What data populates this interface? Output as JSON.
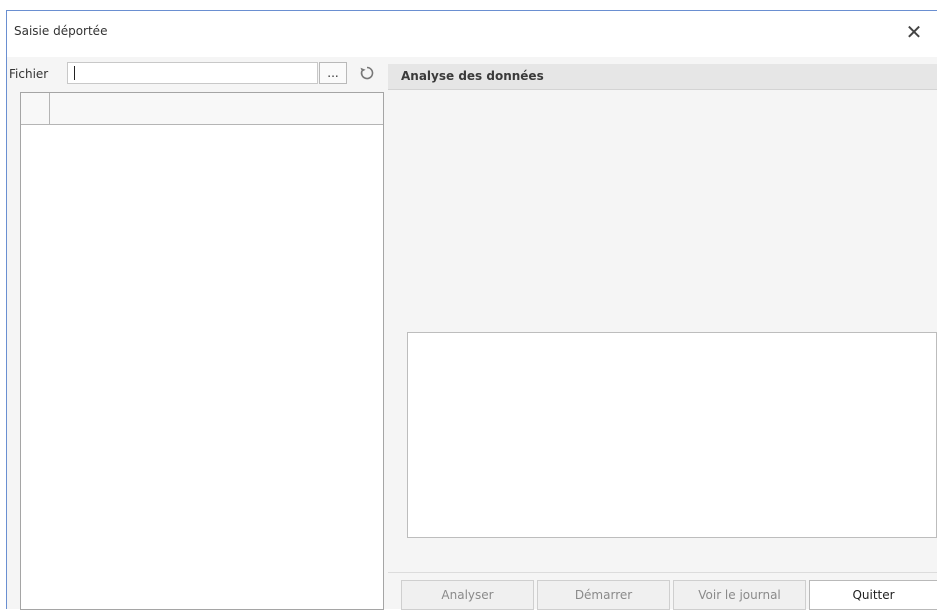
{
  "window": {
    "title": "Saisie déportée"
  },
  "file": {
    "label": "Fichier",
    "value": "",
    "browse_label": "...",
    "refresh_icon": "refresh-icon"
  },
  "analysis": {
    "header": "Analyse des données"
  },
  "buttons": {
    "analyser": "Analyser",
    "demarrer": "Démarrer",
    "voir_journal": "Voir le journal",
    "quitter": "Quitter"
  },
  "colors": {
    "accent": "#6a8fd1",
    "panel_header": "#e6e6e6",
    "background": "#f5f5f5"
  }
}
